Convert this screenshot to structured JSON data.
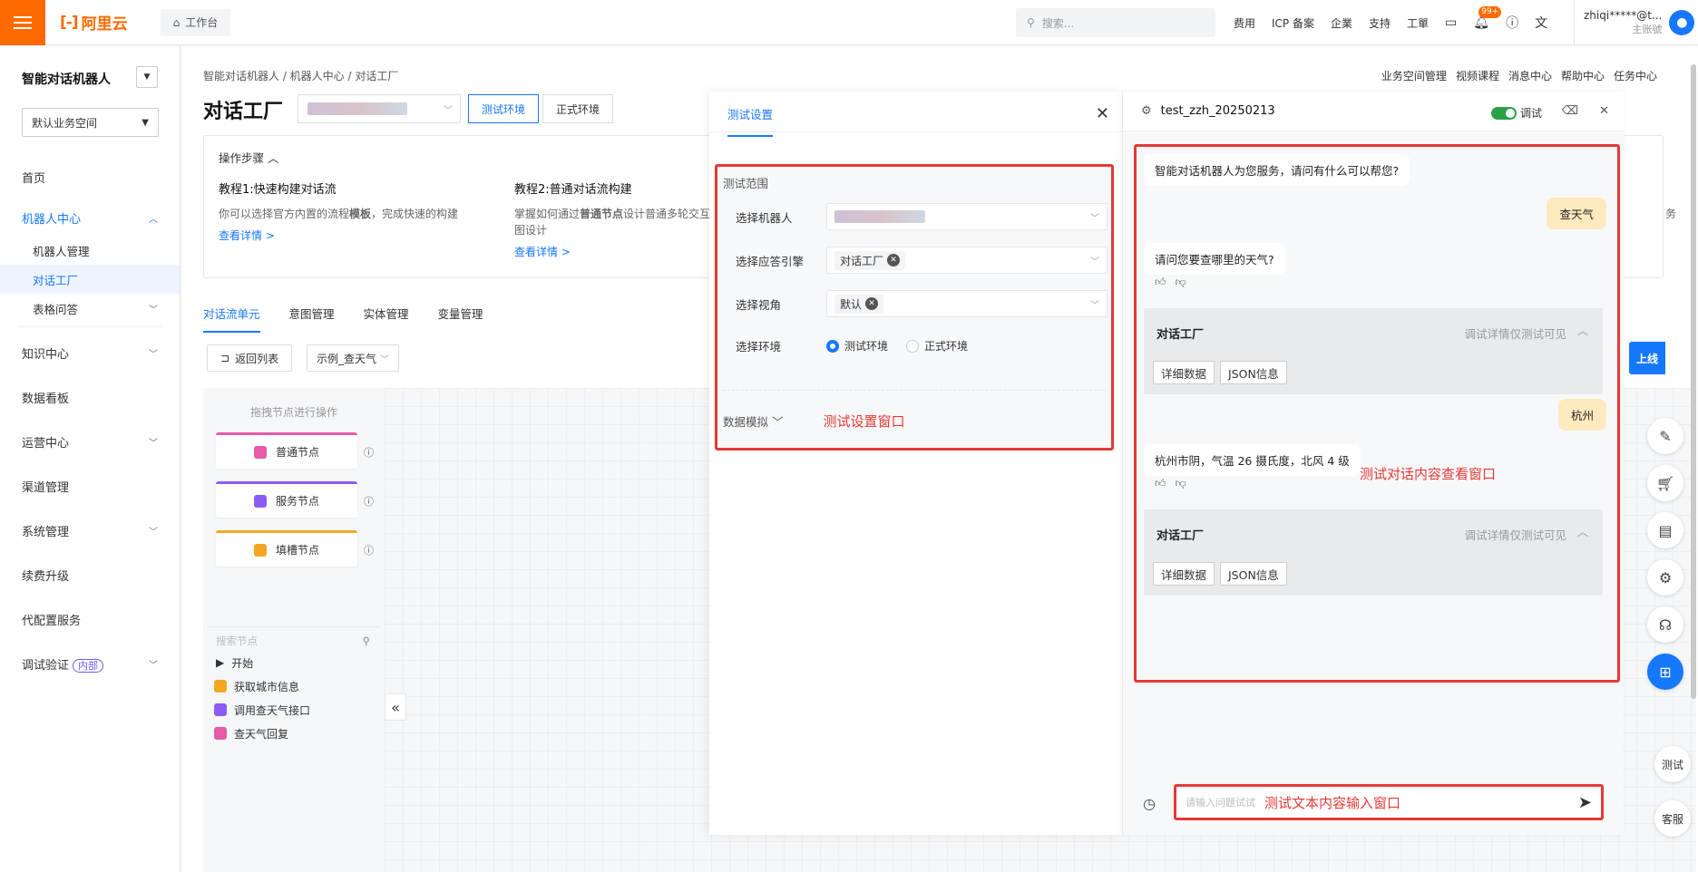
{
  "topbar": {
    "logo_text": "阿里云",
    "workbench": "工作台",
    "search_placeholder": "搜索...",
    "links": [
      "费用",
      "ICP 备案",
      "企業",
      "支持",
      "工單"
    ],
    "notif_badge": "99+",
    "user_name": "zhiqi*****@t...",
    "user_sub": "主账號"
  },
  "sidebar": {
    "title": "智能对话机器人",
    "space": "默认业务空间",
    "home": "首页",
    "robot_center": "机器人中心",
    "robot_manage": "机器人管理",
    "dialog_factory": "对话工厂",
    "table_qa": "表格问答",
    "knowledge_center": "知识中心",
    "data_board": "数据看板",
    "ops_center": "运营中心",
    "channel_manage": "渠道管理",
    "system_manage": "系统管理",
    "renew_upgrade": "续费升级",
    "config_service": "代配置服务",
    "debug_verify": "调试验证",
    "internal_tag": "内部"
  },
  "main": {
    "breadcrumb": "智能对话机器人  /  机器人中心  /  对话工厂",
    "right_links": [
      "业务空间管理",
      "视频课程",
      "消息中心",
      "帮助中心",
      "任务中心"
    ],
    "page_title": "对话工厂",
    "env_test": "测试环境",
    "env_prod": "正式环境",
    "steps_title": "操作步骤",
    "tut1_title": "教程1:快速构建对话流",
    "tut1_desc_pre": "你可以选择官方内置的流程",
    "tut1_desc_bold": "模板",
    "tut1_desc_post": "，完成快速的构建",
    "tut1_link": "查看详情 >",
    "tut2_title": "教程2:普通对话流构建",
    "tut2_desc_pre": "掌握如何通过",
    "tut2_desc_bold": "普通节点",
    "tut2_desc_post": "设计普通多轮交互图设计",
    "tut2_link": "查看详情 >",
    "right_frag": "务",
    "subtabs": [
      "对话流单元",
      "意图管理",
      "实体管理",
      "变量管理"
    ],
    "back_btn": "返回列表",
    "flow_name": "示例_查天气",
    "go_live": "上线",
    "node_hint": "拖拽节点进行操作",
    "nodes": [
      "普通节点",
      "服务节点",
      "填槽节点"
    ],
    "node_search": "搜索节点",
    "tree_root": "开始",
    "tree_items": [
      "获取城市信息",
      "调用查天气接口",
      "查天气回复"
    ],
    "float_test": "测试",
    "float_service": "客服"
  },
  "settings": {
    "tab": "测试设置",
    "scope": "测试范围",
    "robot_label": "选择机器人",
    "engine_label": "选择应答引擎",
    "engine_value": "对话工厂",
    "view_label": "选择视角",
    "view_value": "默认",
    "env_label": "选择环境",
    "env_test": "测试环境",
    "env_prod": "正式环境",
    "data_mock": "数据模拟",
    "annot": "测试设置窗口"
  },
  "chat": {
    "bot_name": "test_zzh_20250213",
    "debug_label": "调试",
    "greeting": "智能对话机器人为您服务，请问有什么可以帮您?",
    "user1": "查天气",
    "bot1": "请问您要查哪里的天气?",
    "card_title": "对话工厂",
    "card_note": "调试详情仅测试可见",
    "btn_detail": "详细数据",
    "btn_json": "JSON信息",
    "user2": "杭州",
    "bot2": "杭州市阴，气温 26 摄氏度，北风 4 级",
    "annot": "测试对话内容查看窗口",
    "input_placeholder": "请输入问题试试",
    "input_annot": "测试文本内容输入窗口"
  },
  "colors": {
    "brand": "#ff6a00",
    "primary": "#1677ff",
    "annotation": "#e53935"
  }
}
